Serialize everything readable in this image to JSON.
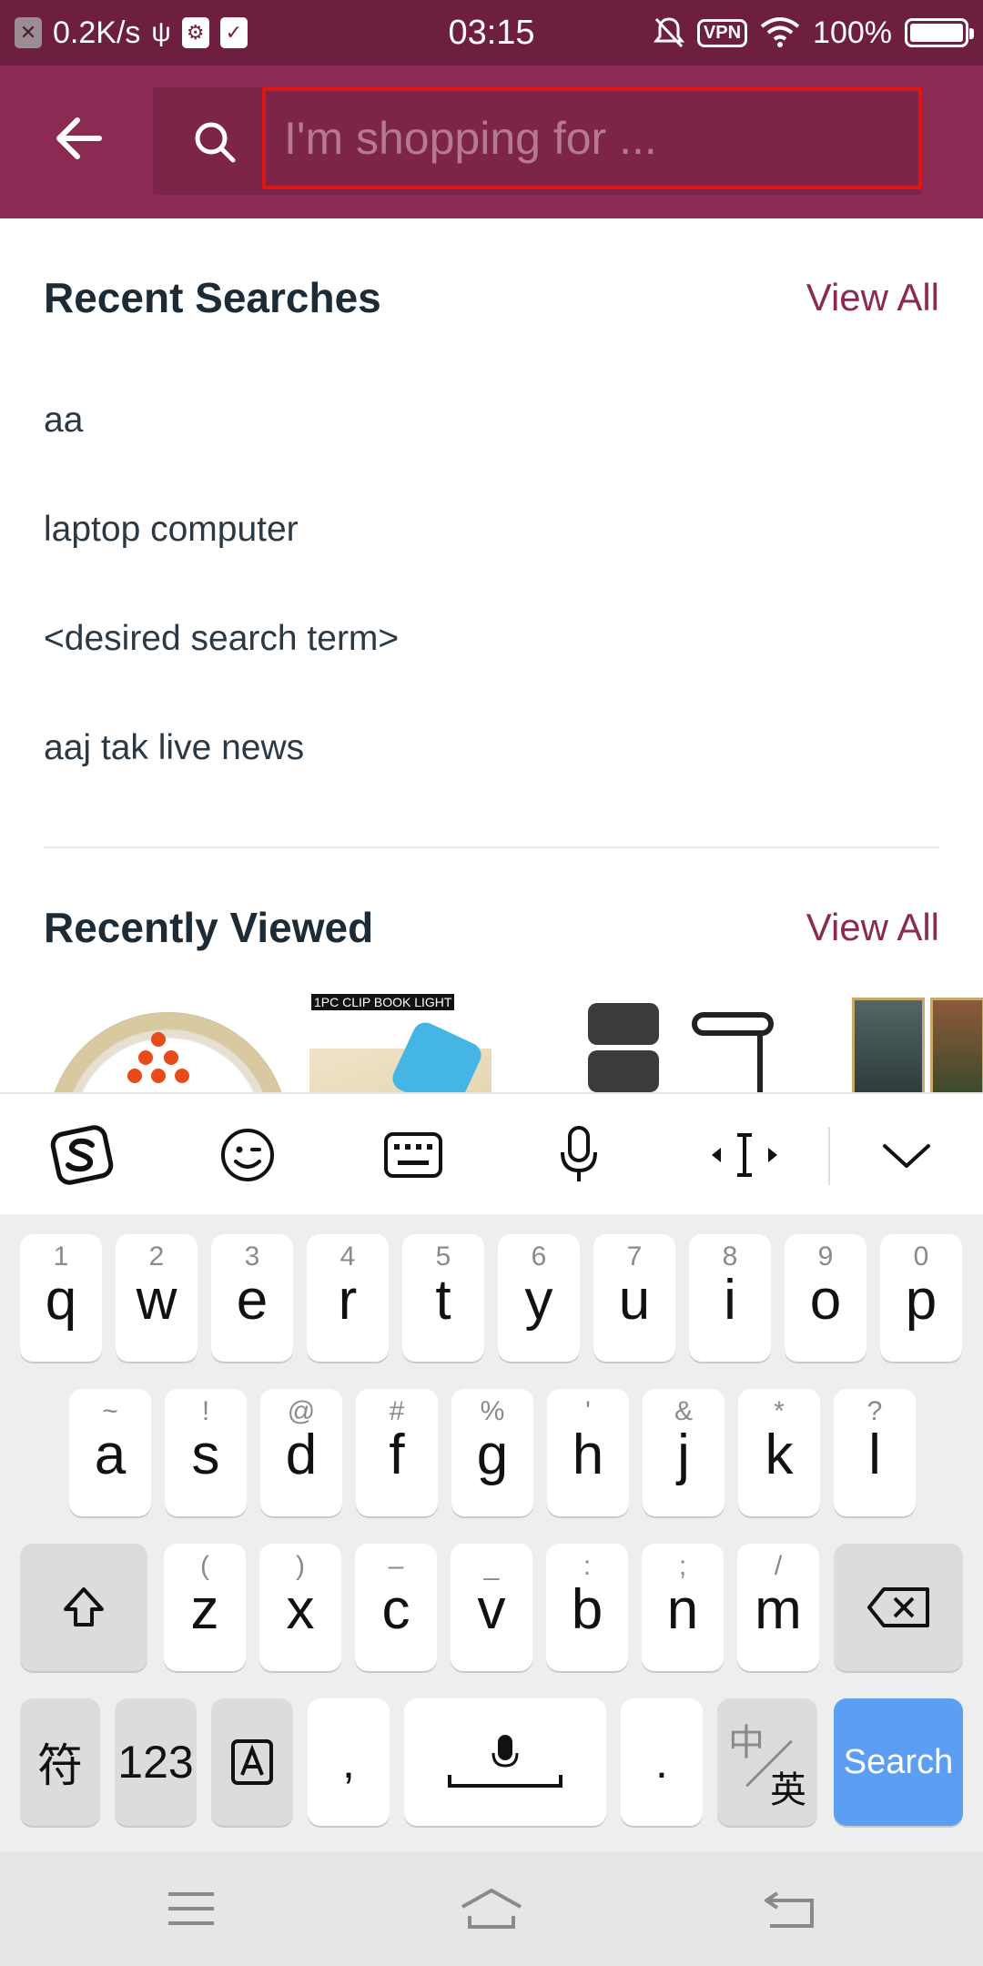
{
  "status_bar": {
    "net_speed": "0.2K/s",
    "time": "03:15",
    "vpn": "VPN",
    "battery": "100%",
    "battery_level": 1.0
  },
  "header": {
    "search_placeholder": "I'm shopping for ..."
  },
  "recent": {
    "title": "Recent Searches",
    "view_all": "View All",
    "items": [
      "aa",
      "laptop computer",
      "<desired search term>",
      "aaj tak live news"
    ]
  },
  "recently_viewed": {
    "title": "Recently Viewed",
    "view_all": "View All",
    "thumb2_label": "1PC CLIP BOOK LIGHT"
  },
  "keyboard": {
    "row1": [
      {
        "hint": "1",
        "key": "q"
      },
      {
        "hint": "2",
        "key": "w"
      },
      {
        "hint": "3",
        "key": "e"
      },
      {
        "hint": "4",
        "key": "r"
      },
      {
        "hint": "5",
        "key": "t"
      },
      {
        "hint": "6",
        "key": "y"
      },
      {
        "hint": "7",
        "key": "u"
      },
      {
        "hint": "8",
        "key": "i"
      },
      {
        "hint": "9",
        "key": "o"
      },
      {
        "hint": "0",
        "key": "p"
      }
    ],
    "row2": [
      {
        "hint": "~",
        "key": "a"
      },
      {
        "hint": "!",
        "key": "s"
      },
      {
        "hint": "@",
        "key": "d"
      },
      {
        "hint": "#",
        "key": "f"
      },
      {
        "hint": "%",
        "key": "g"
      },
      {
        "hint": "'",
        "key": "h"
      },
      {
        "hint": "&",
        "key": "j"
      },
      {
        "hint": "*",
        "key": "k"
      },
      {
        "hint": "?",
        "key": "l"
      }
    ],
    "row3": [
      {
        "hint": "(",
        "key": "z"
      },
      {
        "hint": ")",
        "key": "x"
      },
      {
        "hint": "–",
        "key": "c"
      },
      {
        "hint": "_",
        "key": "v"
      },
      {
        "hint": ":",
        "key": "b"
      },
      {
        "hint": ";",
        "key": "n"
      },
      {
        "hint": "/",
        "key": "m"
      }
    ],
    "symbols": "符",
    "numbers": "123",
    "comma": ",",
    "period": ".",
    "lang_top": "中",
    "lang_bottom": "英",
    "search": "Search"
  }
}
